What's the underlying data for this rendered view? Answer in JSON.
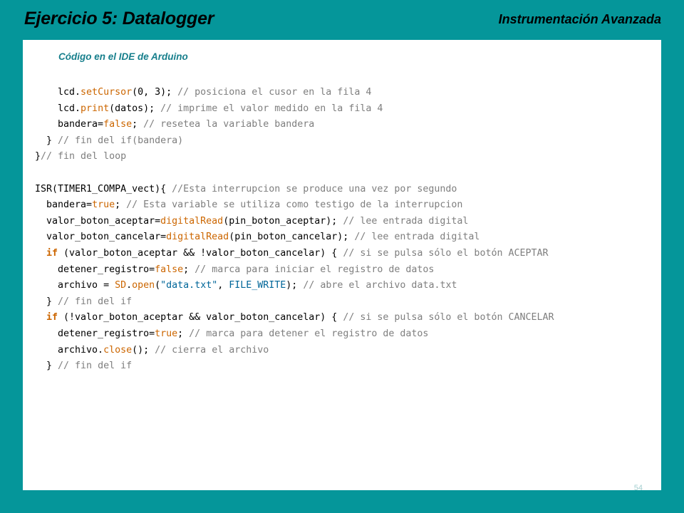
{
  "header": {
    "title": "Ejercicio 5: Datalogger",
    "course": "Instrumentación Avanzada"
  },
  "panel": {
    "caption": "Código  en el IDE de Arduino",
    "page_number": "54"
  },
  "colors": {
    "background": "#05969a",
    "panel": "#ffffff",
    "caption": "#177f8c",
    "keyword": "#cc6600",
    "comment": "#7e7e7e",
    "constant": "#006699"
  },
  "code_lines": [
    [
      [
        "pl",
        "    lcd."
      ],
      [
        "kw",
        "setCursor"
      ],
      [
        "pl",
        "(0, 3); "
      ],
      [
        "cm",
        "// posiciona el cusor en la fila 4"
      ]
    ],
    [
      [
        "pl",
        "    lcd."
      ],
      [
        "kw",
        "print"
      ],
      [
        "pl",
        "(datos); "
      ],
      [
        "cm",
        "// imprime el valor medido en la fila 4"
      ]
    ],
    [
      [
        "pl",
        "    bandera="
      ],
      [
        "kw",
        "false"
      ],
      [
        "pl",
        "; "
      ],
      [
        "cm",
        "// resetea la variable bandera"
      ]
    ],
    [
      [
        "pl",
        "  } "
      ],
      [
        "cm",
        "// fin del if(bandera)"
      ]
    ],
    [
      [
        "pl",
        "}"
      ],
      [
        "cm",
        "// fin del loop"
      ]
    ],
    [
      [
        "pl",
        ""
      ]
    ],
    [
      [
        "pl",
        "ISR(TIMER1_COMPA_vect){ "
      ],
      [
        "cm",
        "//Esta interrupcion se produce una vez por segundo"
      ]
    ],
    [
      [
        "pl",
        "  bandera="
      ],
      [
        "kw",
        "true"
      ],
      [
        "pl",
        "; "
      ],
      [
        "cm",
        "// Esta variable se utiliza como testigo de la interrupcion"
      ]
    ],
    [
      [
        "pl",
        "  valor_boton_aceptar="
      ],
      [
        "kw",
        "digitalRead"
      ],
      [
        "pl",
        "(pin_boton_aceptar); "
      ],
      [
        "cm",
        "// lee entrada digital"
      ]
    ],
    [
      [
        "pl",
        "  valor_boton_cancelar="
      ],
      [
        "kw",
        "digitalRead"
      ],
      [
        "pl",
        "(pin_boton_cancelar); "
      ],
      [
        "cm",
        "// lee entrada digital"
      ]
    ],
    [
      [
        "pl",
        "  "
      ],
      [
        "kwb",
        "if"
      ],
      [
        "pl",
        " (valor_boton_aceptar && !valor_boton_cancelar) { "
      ],
      [
        "cm",
        "// si se pulsa sólo el botón ACEPTAR"
      ]
    ],
    [
      [
        "pl",
        "    detener_registro="
      ],
      [
        "kw",
        "false"
      ],
      [
        "pl",
        "; "
      ],
      [
        "cm",
        "// marca para iniciar el registro de datos"
      ]
    ],
    [
      [
        "pl",
        "    archivo = "
      ],
      [
        "kw",
        "SD"
      ],
      [
        "pl",
        "."
      ],
      [
        "kw",
        "open"
      ],
      [
        "pl",
        "("
      ],
      [
        "str",
        "\"data.txt\""
      ],
      [
        "pl",
        ", "
      ],
      [
        "ct",
        "FILE_WRITE"
      ],
      [
        "pl",
        "); "
      ],
      [
        "cm",
        "// abre el archivo data.txt"
      ]
    ],
    [
      [
        "pl",
        "  } "
      ],
      [
        "cm",
        "// fin del if"
      ]
    ],
    [
      [
        "pl",
        "  "
      ],
      [
        "kwb",
        "if"
      ],
      [
        "pl",
        " (!valor_boton_aceptar && valor_boton_cancelar) { "
      ],
      [
        "cm",
        "// si se pulsa sólo el botón CANCELAR"
      ]
    ],
    [
      [
        "pl",
        "    detener_registro="
      ],
      [
        "kw",
        "true"
      ],
      [
        "pl",
        "; "
      ],
      [
        "cm",
        "// marca para detener el registro de datos"
      ]
    ],
    [
      [
        "pl",
        "    archivo."
      ],
      [
        "kw",
        "close"
      ],
      [
        "pl",
        "(); "
      ],
      [
        "cm",
        "// cierra el archivo"
      ]
    ],
    [
      [
        "pl",
        "  } "
      ],
      [
        "cm",
        "// fin del if"
      ]
    ]
  ]
}
